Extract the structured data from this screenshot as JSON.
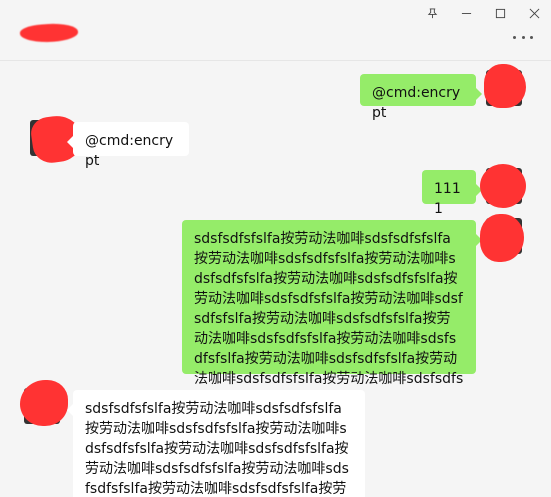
{
  "window": {
    "controls": {
      "pin_icon": "pin-icon",
      "minimize_icon": "minimize-icon",
      "maximize_icon": "maximize-icon",
      "close_icon": "close-icon"
    }
  },
  "header": {
    "more_icon": "more-horizontal-icon"
  },
  "messages": [
    {
      "sender": "me",
      "text": "@cmd:encrypt"
    },
    {
      "sender": "other",
      "text": "@cmd:encrypt"
    },
    {
      "sender": "me",
      "text": "1111"
    },
    {
      "sender": "me",
      "text": "sdsfsdfsfslfa按劳动法咖啡sdsfsdfsfslfa按劳动法咖啡sdsfsdfsfslfa按劳动法咖啡sdsfsdfsfslfa按劳动法咖啡sdsfsdfsfslfa按劳动法咖啡sdsfsdfsfslfa按劳动法咖啡sdsfsdfsfslfa按劳动法咖啡sdsfsdfsfslfa按劳动法咖啡sdsfsdfsfslfa按劳动法咖啡sdsfsdfsfslfa按劳动法咖啡sdsfsdfsfslfa按劳动法咖啡sdsfsdfsfslfa按劳动法咖啡sdsfsdfsfslfa按劳动法咖啡"
    },
    {
      "sender": "other",
      "text": "sdsfsdfsfslfa按劳动法咖啡sdsfsdfsfslfa按劳动法咖啡sdsfsdfsfslfa按劳动法咖啡sdsfsdfsfslfa按劳动法咖啡sdsfsdfsfslfa按劳动法咖啡sdsfsdfsfslfa按劳动法咖啡sdsfsdfsfslfa按劳动法咖啡sdsfsdfsfslfa按劳"
    }
  ],
  "colors": {
    "my_bubble": "#95ec69",
    "other_bubble": "#ffffff",
    "background": "#f5f5f5",
    "redaction": "#ff3333"
  }
}
